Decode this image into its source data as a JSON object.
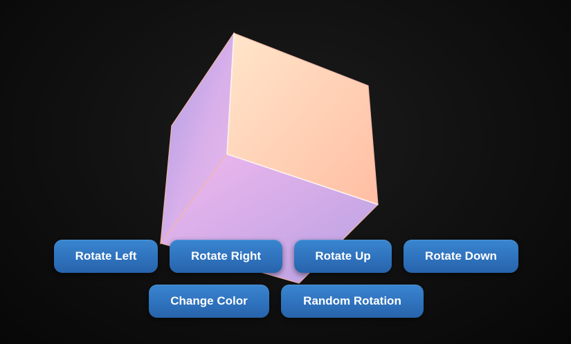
{
  "buttons": {
    "rotate_left": "Rotate Left",
    "rotate_right": "Rotate Right",
    "rotate_up": "Rotate Up",
    "rotate_down": "Rotate Down",
    "change_color": "Change Color",
    "random_rotation": "Random Rotation"
  },
  "colors": {
    "background": "#0d0d0d",
    "button": "#2f72bd",
    "button_text": "#ffffff",
    "face_front": [
      "#ffe3c8",
      "#ffbfa6"
    ],
    "face_left": [
      "#a89ee6",
      "#e6b6ea"
    ],
    "face_bottom": [
      "#efb6ee",
      "#b9a2e4"
    ],
    "edge": "#f3b8a4"
  }
}
